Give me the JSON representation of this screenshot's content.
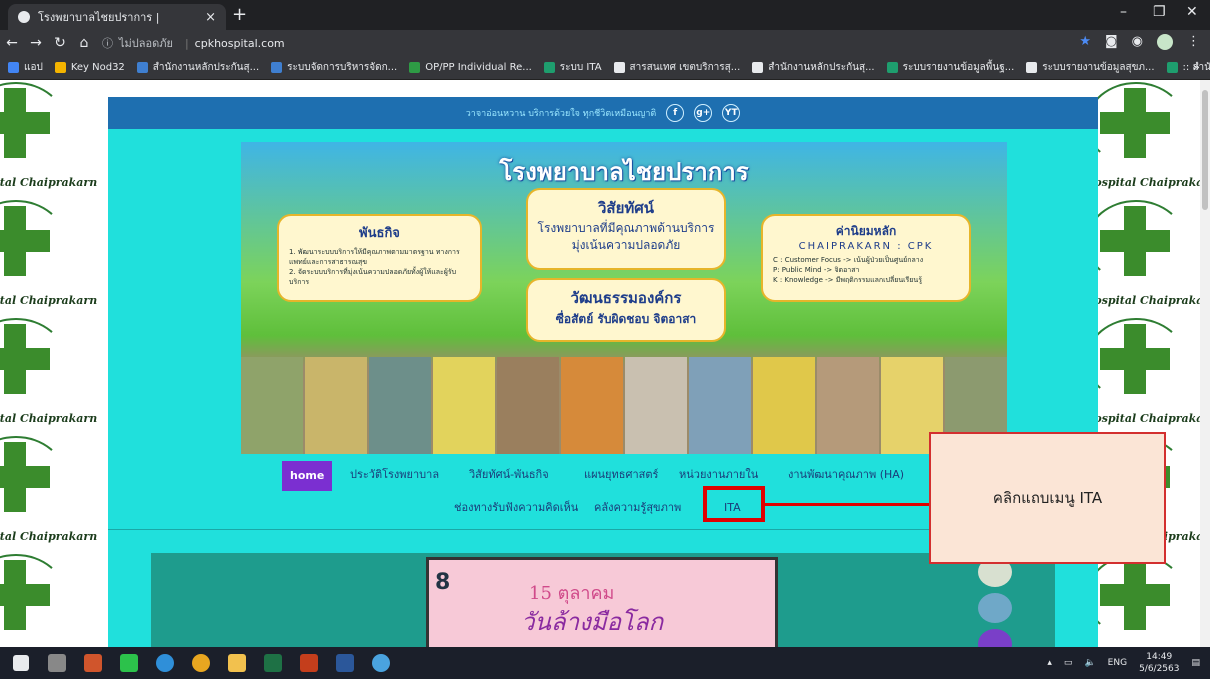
{
  "browser": {
    "tab_title": "โรงพยาบาลไชยปราการ |",
    "tab_close": "×",
    "new_tab": "+",
    "insecure_label": "ไม่ปลอดภัย",
    "url": "cpkhospital.com",
    "window_controls": [
      "–",
      "❐",
      "✕"
    ]
  },
  "bookmarks": [
    {
      "label": "แอป",
      "color": "#4285f4"
    },
    {
      "label": "Key Nod32",
      "color": "#f4b400"
    },
    {
      "label": "สำนักงานหลักประกันสุ...",
      "color": "#3f7fd0"
    },
    {
      "label": "ระบบจัดการบริหารจัดก...",
      "color": "#3f7fd0"
    },
    {
      "label": "OP/PP Individual Re...",
      "color": "#2e9b45"
    },
    {
      "label": "ระบบ ITA",
      "color": "#1e9e6e"
    },
    {
      "label": "สารสนเทศ เขตบริการสุ...",
      "color": "#e8eaed"
    },
    {
      "label": "สำนักงานหลักประกันสุ...",
      "color": "#e8eaed"
    },
    {
      "label": "ระบบรายงานข้อมูลพื้นฐ...",
      "color": "#1e9e6e"
    },
    {
      "label": "ระบบรายงานข้อมูลสุขภ...",
      "color": "#e8eaed"
    },
    {
      "label": ":: สำนักงานสาธารณสุข...",
      "color": "#1e9e6e"
    }
  ],
  "bookmarks_more": "»",
  "background": {
    "watermark": "Hospital Chaiprakarn"
  },
  "site": {
    "slogan": "วาจาอ่อนหวาน บริการด้วยใจ ทุกชีวิตเหมือนญาติ",
    "social": [
      "f",
      "g+",
      "YT"
    ],
    "banner": {
      "title": "โรงพยาบาลไชยปราการ",
      "vision_heading": "วิสัยทัศน์",
      "vision_line1": "โรงพยาบาลที่มีคุณภาพด้านบริการ",
      "vision_line2": "มุ่งเน้นความปลอดภัย",
      "mission_heading": "พันธกิจ",
      "mission_line1": "1. พัฒนาระบบบริการให้มีคุณภาพตามมาตรฐาน ทางการแพทย์และการสาธารณสุข",
      "mission_line2": "2. จัดระบบบริการที่มุ่งเน้นความปลอดภัยทั้งผู้ให้และผู้รับบริการ",
      "values_heading": "ค่านิยมหลัก",
      "values_sub": "CHAIPRAKARN : CPK",
      "values_c": "C : Customer Focus -> เน้นผู้ป่วยเป็นศูนย์กลาง",
      "values_p": "P: Public Mind -> จิตอาสา",
      "values_k": "K : Knowledge -> มีพฤติกรรมแลกเปลี่ยนเรียนรู้",
      "culture_heading": "วัฒนธรรมองค์กร",
      "culture_line": "ซื่อสัตย์ รับผิดชอบ จิตอาสา"
    },
    "menu": {
      "home": "home",
      "history": "ประวัติโรงพยาบาล",
      "vision_mission": "วิสัยทัศน์-พันธกิจ",
      "strategy": "แผนยุทธศาสตร์",
      "units": "หน่วยงานภายใน",
      "quality": "งานพัฒนาคุณภาพ (HA)",
      "feedback": "ช่องทางรับฟังความคิดเห็น",
      "knowledge": "คลังความรู้สุขภาพ",
      "ita": "ITA"
    },
    "poster": {
      "number": "8",
      "line1": "15 ตุลาคม",
      "line2": "วันล้างมือโลก"
    }
  },
  "annotation": {
    "text": "คลิกแถบเมนู ITA"
  },
  "taskbar": {
    "language": "ENG",
    "time": "14:49",
    "date": "5/6/2563"
  }
}
